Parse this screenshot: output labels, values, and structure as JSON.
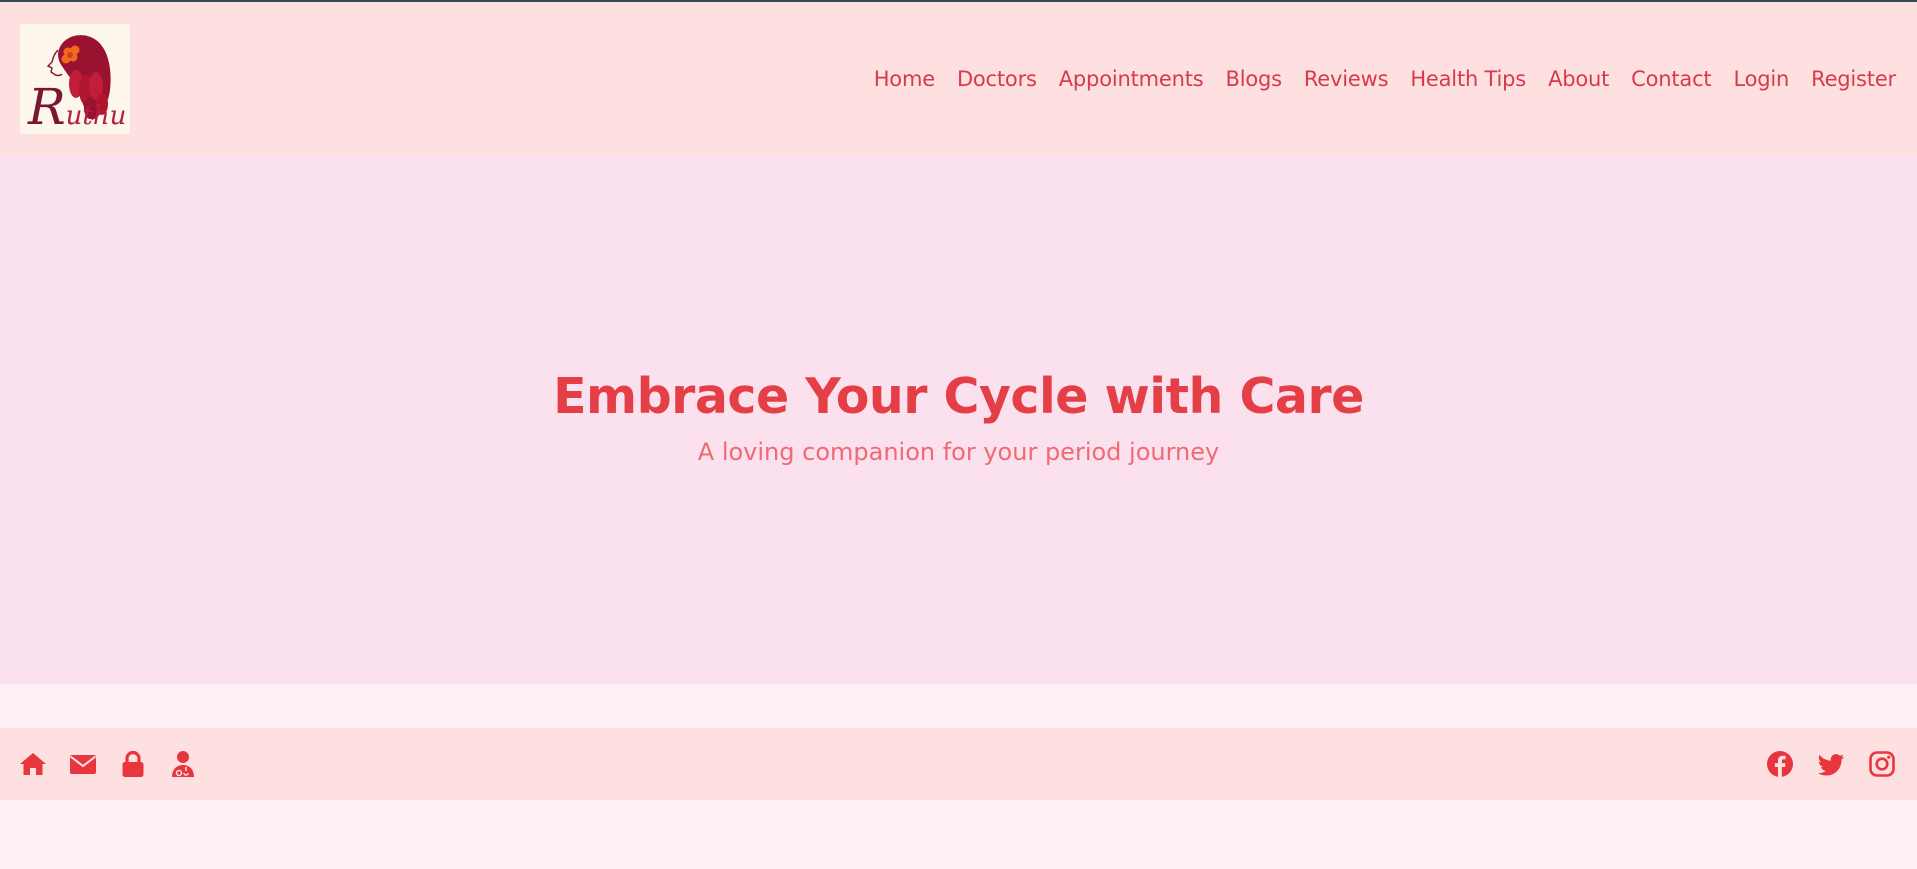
{
  "logo": {
    "letter": "R",
    "rest": "uthu"
  },
  "nav": [
    "Home",
    "Doctors",
    "Appointments",
    "Blogs",
    "Reviews",
    "Health Tips",
    "About",
    "Contact",
    "Login",
    "Register"
  ],
  "hero": {
    "title": "Embrace Your Cycle with Care",
    "subtitle": "A loving companion for your period journey"
  },
  "footer": {
    "left_icons": [
      "home-icon",
      "envelope-icon",
      "lock-icon",
      "doctor-icon"
    ],
    "right_icons": [
      "facebook-icon",
      "twitter-icon",
      "instagram-icon"
    ]
  },
  "colors": {
    "accent": "#e43f46",
    "header_bg": "#ffe0e1",
    "hero_bg": "#fbe0ee",
    "page_bg": "#fdf0f5"
  }
}
